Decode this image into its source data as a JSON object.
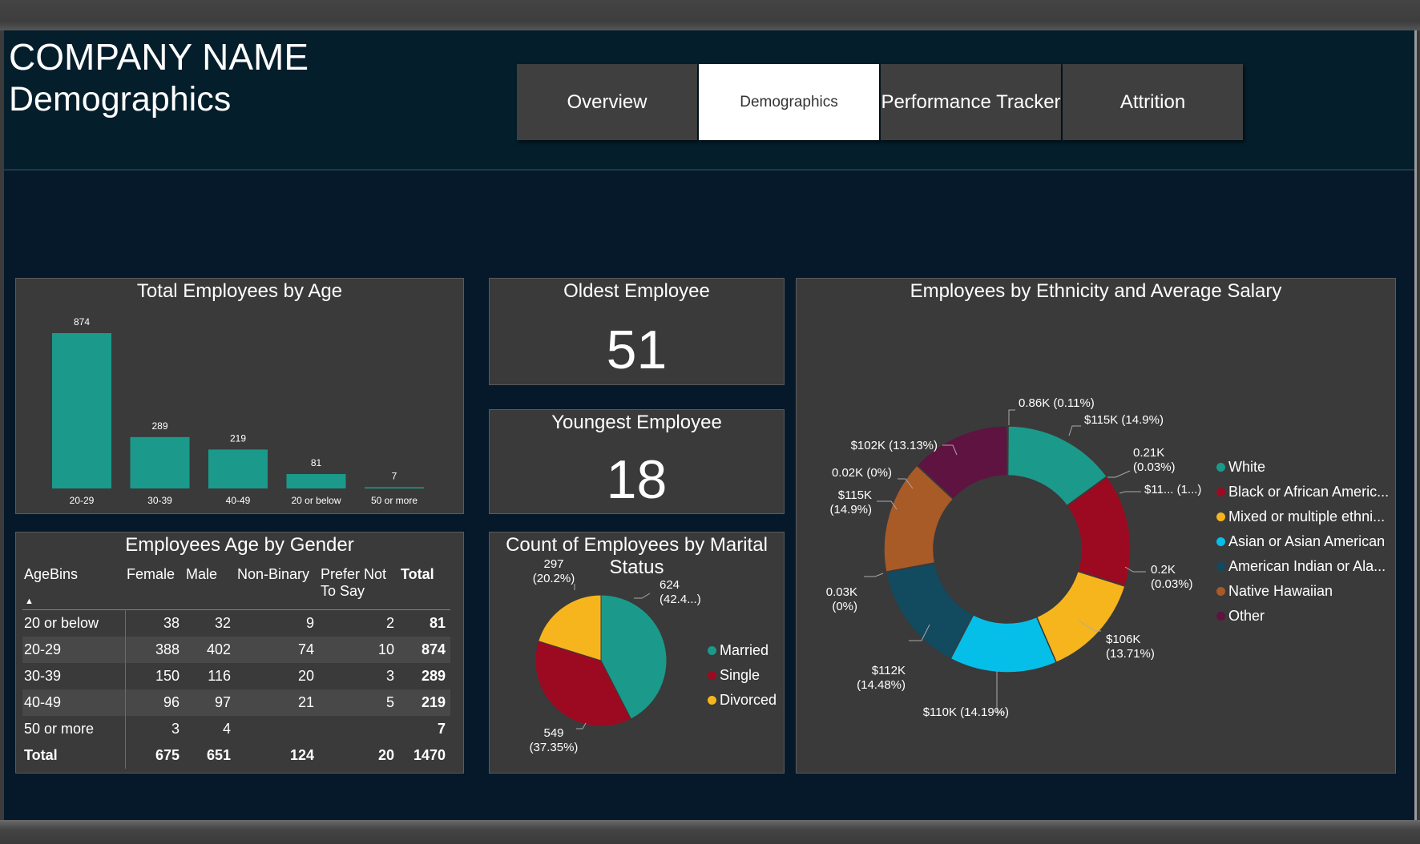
{
  "header": {
    "company": "COMPANY NAME",
    "page_title": "Demographics",
    "nav": [
      {
        "label": "Overview",
        "active": false
      },
      {
        "label": "Demographics",
        "active": true
      },
      {
        "label": "Performance Tracker",
        "active": false
      },
      {
        "label": "Attrition",
        "active": false
      }
    ]
  },
  "colors": {
    "teal": "#1b9a8b",
    "red": "#9c0a22",
    "yellow": "#f7b51d",
    "cyan": "#06bfe8",
    "navy": "#124a5f",
    "orange": "#a85a27",
    "plum": "#5e1340"
  },
  "oldest": {
    "title": "Oldest Employee",
    "value": "51"
  },
  "youngest": {
    "title": "Youngest Employee",
    "value": "18"
  },
  "age_table": {
    "title": "Employees Age by Gender",
    "headers": [
      "AgeBins",
      "Female",
      "Male",
      "Non-Binary",
      "Prefer Not To Say",
      "Total"
    ],
    "rows": [
      [
        "20 or below",
        "38",
        "32",
        "9",
        "2",
        "81"
      ],
      [
        "20-29",
        "388",
        "402",
        "74",
        "10",
        "874"
      ],
      [
        "30-39",
        "150",
        "116",
        "20",
        "3",
        "289"
      ],
      [
        "40-49",
        "96",
        "97",
        "21",
        "5",
        "219"
      ],
      [
        "50 or more",
        "3",
        "4",
        "",
        "",
        "7"
      ]
    ],
    "total": [
      "Total",
      "675",
      "651",
      "124",
      "20",
      "1470"
    ]
  },
  "chart_data": [
    {
      "type": "bar",
      "title": "Total Employees by Age",
      "categories": [
        "20-29",
        "30-39",
        "40-49",
        "20 or below",
        "50 or more"
      ],
      "values": [
        874,
        289,
        219,
        81,
        7
      ]
    },
    {
      "type": "pie",
      "title": "Count of Employees by Marital Status",
      "categories": [
        "Married",
        "Single",
        "Divorced"
      ],
      "values": [
        624,
        549,
        297
      ],
      "labels": [
        [
          "624",
          "(42.4...)"
        ],
        [
          "549",
          "(37.35%)"
        ],
        [
          "297",
          "(20.2%)"
        ]
      ]
    },
    {
      "type": "pie",
      "title": "Employees by Ethnicity and Average Salary",
      "legend": [
        "White",
        "Black or African Americ...",
        "Mixed or multiple ethni...",
        "Asian or Asian American",
        "American Indian or Ala...",
        "Native Hawaiian",
        "Other"
      ],
      "slices": [
        {
          "label": [
            "0.86K (0.11%)"
          ],
          "share": 0.11
        },
        {
          "label": [
            "$115K (14.9%)"
          ],
          "share": 14.9
        },
        {
          "label": [
            "0.21K",
            "(0.03%)"
          ],
          "share": 0.03
        },
        {
          "label": [
            "$11... (1...)"
          ],
          "share": 14.9
        },
        {
          "label": [
            "0.2K",
            "(0.03%)"
          ],
          "share": 0.03
        },
        {
          "label": [
            "$106K",
            "(13.71%)"
          ],
          "share": 13.71
        },
        {
          "label": [
            "$110K (14.19%)"
          ],
          "share": 14.19
        },
        {
          "label": [
            "$112K",
            "(14.48%)"
          ],
          "share": 14.48
        },
        {
          "label": [
            "0.03K",
            "(0%)"
          ],
          "share": 0.03
        },
        {
          "label": [
            "$115K",
            "(14.9%)"
          ],
          "share": 14.9
        },
        {
          "label": [
            "0.02K (0%)"
          ],
          "share": 0.02
        },
        {
          "label": [
            "$102K (13.13%)"
          ],
          "share": 13.13
        }
      ]
    }
  ]
}
